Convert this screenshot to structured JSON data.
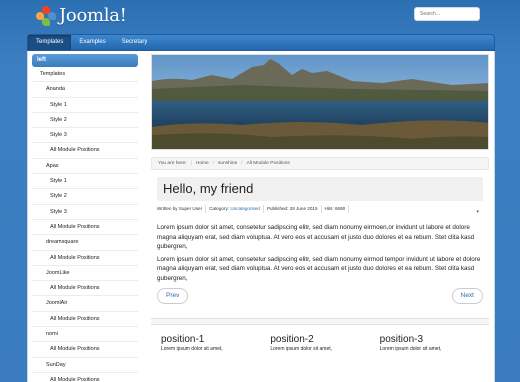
{
  "header": {
    "logo_text": "Joomla!",
    "search_placeholder": "Search..."
  },
  "nav": {
    "items": [
      {
        "label": "Templates",
        "active": true
      },
      {
        "label": "Examples",
        "active": false
      },
      {
        "label": "Secretary",
        "active": false
      }
    ]
  },
  "sidebar": {
    "heading": "left",
    "items": [
      {
        "label": "Templates",
        "level": 0
      },
      {
        "label": "Ananda",
        "level": 1
      },
      {
        "label": "Style 1",
        "level": 2
      },
      {
        "label": "Style 2",
        "level": 2
      },
      {
        "label": "Style 3",
        "level": 2
      },
      {
        "label": "All Module Positions",
        "level": 2
      },
      {
        "label": "Apas",
        "level": 1
      },
      {
        "label": "Style 1",
        "level": 2
      },
      {
        "label": "Style 2",
        "level": 2
      },
      {
        "label": "Style 3",
        "level": 2
      },
      {
        "label": "All Module Positions",
        "level": 2
      },
      {
        "label": "dreamsquare",
        "level": 1
      },
      {
        "label": "All Module Positions",
        "level": 2
      },
      {
        "label": "JoomLike",
        "level": 1
      },
      {
        "label": "All Module Positions",
        "level": 2
      },
      {
        "label": "JoomlAir",
        "level": 1
      },
      {
        "label": "All Module Positions",
        "level": 2
      },
      {
        "label": "nomi",
        "level": 1
      },
      {
        "label": "All Module Positions",
        "level": 2
      },
      {
        "label": "SunDay",
        "level": 1
      },
      {
        "label": "All Module Positions",
        "level": 2
      }
    ]
  },
  "breadcrumb": {
    "prefix": "You are here:",
    "items": [
      "Home",
      "sunshine",
      "All Module Positions"
    ]
  },
  "article": {
    "title": "Hello, my friend",
    "meta": {
      "author": "Written by Super User",
      "category_label": "Category:",
      "category": "Uncategorised",
      "published": "Published: 28 June 2015",
      "hits": "Hits: 6690"
    },
    "paragraphs": [
      "Lorem ipsum dolor sit amet, consetetur sadipscing elitr, sed diam nonumy eirmoen,or invidunt ut labore et dolore magna aliquyam erat, sed diam voluptua. At vero eos et accusam et justo duo dolores et ea rebum. Stet clita kasd gubergren,",
      "Lorem ipsum dolor sit amet, consetetur sadipscing elitr, sed diam nonumy eirmod tempor invidunt ut labore et dolore magna aliquyam erat, sed diam voluptua. At vero eos et accusam et justo duo dolores et ea rebum. Stet clita kasd gubergren,"
    ],
    "prev_label": "Prev",
    "next_label": "Next"
  },
  "positions": [
    {
      "title": "position-1",
      "text": "Lorem ipsum dolor sit amet,"
    },
    {
      "title": "position-2",
      "text": "Lorem ipsum dolor sit amet,"
    },
    {
      "title": "position-3",
      "text": "Lorem ipsum dolor sit amet,"
    }
  ],
  "colors": {
    "background": "#3a7cbf",
    "nav_bar": "#2466ad",
    "nav_active": "#1b4e85",
    "link": "#2a6cb0"
  }
}
